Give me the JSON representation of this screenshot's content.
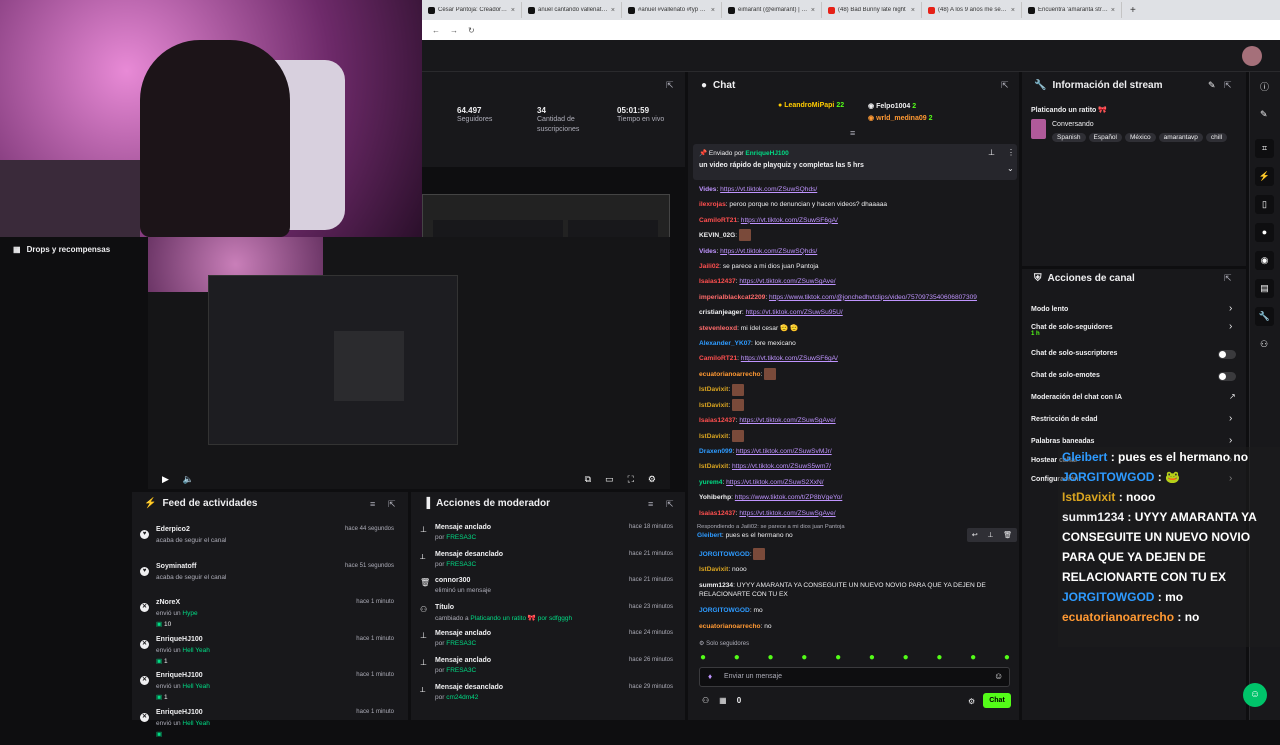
{
  "browser": {
    "tabs": [
      {
        "label": "César Pantoja: Creadoras al",
        "kind": "tt"
      },
      {
        "label": "anuel cantando vallenato #a",
        "kind": "tt"
      },
      {
        "label": "#anuel #vallenato #fyp #fyp",
        "kind": "tt"
      },
      {
        "label": "eimarant (@eimarant) | TikTo",
        "kind": "tt"
      },
      {
        "label": "(48) Bad Bunny late night",
        "kind": "yt"
      },
      {
        "label": "(48) A los 9 años me secuest",
        "kind": "yt"
      },
      {
        "label": "Encuentra 'amaranta stream",
        "kind": "tt"
      }
    ],
    "new_tab": "+"
  },
  "stats": [
    {
      "value": "64.497",
      "label": "Seguidores"
    },
    {
      "value": "34",
      "label": "Cantidad de suscripciones"
    },
    {
      "value": "05:01:59",
      "label": "Tiempo en vivo"
    }
  ],
  "drops": {
    "label": "Drops y recompensas"
  },
  "chat": {
    "title": "Chat",
    "top": [
      {
        "name": "LeandroMiPapi",
        "count": "22",
        "color": "#ffcc00"
      },
      {
        "name": "Felpo1004",
        "count": "2",
        "color": "#efeff1"
      },
      {
        "name": "wrld_medina09",
        "count": "2",
        "color": "#ff9933"
      }
    ],
    "pinned": {
      "by_label": "Enviado por",
      "by": "EnriqueHJ100",
      "text": "un video rápido de playquiz y completas las 5 hrs"
    },
    "messages": [
      {
        "name": "Vides",
        "color": "#bf94ff",
        "text": ": ",
        "link": "https://vt.tiktok.com/ZSuwSQhds/"
      },
      {
        "name": "ilexrojas",
        "color": "#ff4f4f",
        "text": ": peroo porque no denuncian y hacen videos? dhaaaaa",
        "link": ""
      },
      {
        "name": "CamiloRT21",
        "color": "#ff4f4f",
        "text": ": ",
        "link": "https://vt.tiktok.com/ZSuwSF6gA/"
      },
      {
        "name": "KEVIN_02G",
        "color": "#efeff1",
        "text": ": ",
        "link": "",
        "emote": true
      },
      {
        "name": "Vides",
        "color": "#bf94ff",
        "text": ": ",
        "link": "https://vt.tiktok.com/ZSuwSQhds/"
      },
      {
        "name": "Jaili02",
        "color": "#ff4f4f",
        "text": ": se parece a mi dios juan Pantoja",
        "link": ""
      },
      {
        "name": "Isaias12437",
        "color": "#ff4f4f",
        "text": ": ",
        "link": "https://vt.tiktok.com/ZSuwSgAve/"
      },
      {
        "name": "imperialblackcat2209",
        "color": "#ff6b6b",
        "text": ": ",
        "link": "https://www.tiktok.com/@jonchedhvtclips/video/7570973540606807309"
      },
      {
        "name": "cristianjeager",
        "color": "#efeff1",
        "text": ": ",
        "link": "https://vt.tiktok.com/ZSuwSu95U/"
      },
      {
        "name": "stevenleoxd",
        "color": "#ff6b6b",
        "text": ": mi ídel cesar 🫡 🫡",
        "link": ""
      },
      {
        "name": "Alexander_YK07",
        "color": "#2e9bff",
        "text": ": lore mexicano",
        "link": ""
      },
      {
        "name": "CamiloRT21",
        "color": "#ff4f4f",
        "text": ": ",
        "link": "https://vt.tiktok.com/ZSuwSF6gA/"
      },
      {
        "name": "ecuatorianoarrecho",
        "color": "#ff9933",
        "text": ": ",
        "link": "",
        "emote": true
      },
      {
        "name": "IstDavixit",
        "color": "#daa520",
        "text": ": ",
        "link": "",
        "emote": true
      },
      {
        "name": "IstDavixit",
        "color": "#daa520",
        "text": ": ",
        "link": "",
        "emote": true
      },
      {
        "name": "Isaias12437",
        "color": "#ff4f4f",
        "text": ": ",
        "link": "https://vt.tiktok.com/ZSuwSgAve/"
      },
      {
        "name": "IstDavixit",
        "color": "#daa520",
        "text": ": ",
        "link": "",
        "emote": true
      },
      {
        "name": "Draxen099",
        "color": "#2e9bff",
        "text": ": ",
        "link": "https://vt.tiktok.com/ZSuwSvMJr/"
      },
      {
        "name": "IstDavixit",
        "color": "#daa520",
        "text": ": ",
        "link": "https://vt.tiktok.com/ZSuwS5wm7/"
      },
      {
        "name": "yurem4",
        "color": "#00db84",
        "text": ": ",
        "link": "https://vt.tiktok.com/ZSuwS2XxN/"
      },
      {
        "name": "Yohiberhp",
        "color": "#efeff1",
        "text": ": ",
        "link": "https://www.tiktok.com/t/ZP8bVgeYo/"
      },
      {
        "name": "Isaias12437",
        "color": "#ff4f4f",
        "text": ": ",
        "link": "https://vt.tiktok.com/ZSuwSgAve/"
      }
    ],
    "reply": {
      "label": "Respondiendo a Jaili02: se parece a mi dios juan Pantoja",
      "name": "Gleibert",
      "text": ": pues es el hermano no"
    },
    "messages2": [
      {
        "name": "JORGITOWGOD",
        "color": "#2e9bff",
        "text": ": ",
        "emote": true
      },
      {
        "name": "IstDavixit",
        "color": "#daa520",
        "text": ": nooo"
      },
      {
        "name": "summ1234",
        "color": "#efeff1",
        "text": ": UYYY AMARANTA YA CONSEGUITE UN NUEVO NOVIO PARA QUE YA DEJEN DE"
      },
      {
        "name": "",
        "color": "#efeff1",
        "text": "RELACIONARTE CON TU EX"
      },
      {
        "name": "JORGITOWGOD",
        "color": "#2e9bff",
        "text": ": mo"
      },
      {
        "name": "ecuatorianoarrecho",
        "color": "#ff9933",
        "text": ": no"
      }
    ],
    "followers_only": "Solo seguidores",
    "input_placeholder": "Enviar un mensaje",
    "viewers": "0",
    "send": "Chat"
  },
  "stream_info": {
    "title": "Información del stream",
    "stream_title": "Platicando un ratito 🎀",
    "category": "Conversando",
    "tags": [
      "Spanish",
      "Español",
      "México",
      "amarantavp",
      "chill"
    ]
  },
  "channel_actions": {
    "title": "Acciones de canal",
    "items": [
      {
        "label": "Modo lento",
        "kind": "chevron"
      },
      {
        "label": "Chat de solo-seguidores",
        "sub": "1 h",
        "kind": "chevron"
      },
      {
        "label": "Chat de solo-suscriptores",
        "kind": "toggle"
      },
      {
        "label": "Chat de solo-emotes",
        "kind": "toggle"
      },
      {
        "label": "Moderación del chat con IA",
        "kind": "ext"
      },
      {
        "label": "Restricción de edad",
        "kind": "chevron"
      },
      {
        "label": "Palabras baneadas",
        "kind": "chevron"
      },
      {
        "label": "Hostear canal",
        "kind": "chevron"
      },
      {
        "label": "Configuración",
        "kind": "chevron"
      }
    ]
  },
  "activity": {
    "title": "Feed de actividades",
    "items": [
      {
        "icon": "heart",
        "name": "Ederpico2",
        "time": "hace 44 segundos",
        "sub": "acaba de seguir el canal"
      },
      {
        "icon": "heart",
        "name": "Soyminatoff",
        "time": "hace 51 segundos",
        "sub": "acaba de seguir el canal"
      },
      {
        "icon": "kick",
        "name": "zNoreX",
        "time": "hace 1 minuto",
        "sub": "envió un",
        "kicks": "Hype",
        "count": "10"
      },
      {
        "icon": "kick",
        "name": "EnriqueHJ100",
        "time": "hace 1 minuto",
        "sub": "envió un",
        "kicks": "Hell Yeah",
        "count": "1"
      },
      {
        "icon": "kick",
        "name": "EnriqueHJ100",
        "time": "hace 1 minuto",
        "sub": "envió un",
        "kicks": "Hell Yeah",
        "count": "1"
      },
      {
        "icon": "kick",
        "name": "EnriqueHJ100",
        "time": "hace 1 minuto",
        "sub": "envió un",
        "kicks": "Hell Yeah",
        "count": ""
      }
    ]
  },
  "mod": {
    "title": "Acciones de moderador",
    "items": [
      {
        "icon": "pin",
        "name": "Mensaje anclado",
        "time": "hace 18 minutos",
        "pre": "por",
        "by": "FRESA3C"
      },
      {
        "icon": "unpin",
        "name": "Mensaje desanclado",
        "time": "hace 21 minutos",
        "pre": "por",
        "by": "FRESA3C"
      },
      {
        "icon": "trash",
        "name": "connor300",
        "time": "hace 21 minutos",
        "pre": "eliminó un mensaje",
        "by": ""
      },
      {
        "icon": "title",
        "name": "Título",
        "time": "hace 23 minutos",
        "pre": "cambiado a",
        "by": "Platicando un ratito 🎀 por sdfgggh"
      },
      {
        "icon": "pin",
        "name": "Mensaje anclado",
        "time": "hace 24 minutos",
        "pre": "por",
        "by": "FRESA3C"
      },
      {
        "icon": "pin",
        "name": "Mensaje anclado",
        "time": "hace 26 minutos",
        "pre": "por",
        "by": "FRESA3C"
      },
      {
        "icon": "unpin",
        "name": "Mensaje desanclado",
        "time": "hace 29 minutos",
        "pre": "por",
        "by": "cm24dm42"
      }
    ]
  },
  "overlay_chat": [
    {
      "name": "Gleibert",
      "color": "#2e9bff",
      "text": " : pues es el hermano no"
    },
    {
      "name": "JORGITOWGOD",
      "color": "#2e9bff",
      "text": " : "
    },
    {
      "name": "IstDavixit",
      "color": "#daa520",
      "text": " : nooo"
    },
    {
      "name": "summ1234",
      "color": "#efeff1",
      "text": " : UYYY AMARANTA YA"
    },
    {
      "name": "",
      "color": "#efeff1",
      "text": "CONSEGUITE UN NUEVO NOVIO"
    },
    {
      "name": "",
      "color": "#efeff1",
      "text": "PARA QUE YA DEJEN DE"
    },
    {
      "name": "",
      "color": "#efeff1",
      "text": "RELACIONARTE CON TU EX"
    },
    {
      "name": "JORGITOWGOD",
      "color": "#2e9bff",
      "text": " : mo"
    },
    {
      "name": "ecuatorianoarrecho",
      "color": "#ff9933",
      "text": " : no"
    }
  ],
  "colors": {
    "accent": "#53fc18",
    "bg": "#0e0e10",
    "panel": "#18181b"
  }
}
